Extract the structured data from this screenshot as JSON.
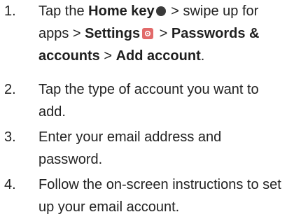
{
  "steps": [
    {
      "number": "1.",
      "segments": {
        "s1": "Tap the ",
        "s2": "Home key",
        "s3": " > swipe up for apps > ",
        "s4": "Settings",
        "s5": " > ",
        "s6": "Passwords & accounts",
        "s7": " > ",
        "s8": "Add account",
        "s9": "."
      },
      "icons": [
        "home-key-dot-icon",
        "settings-gear-icon"
      ]
    },
    {
      "number": "2.",
      "text": "Tap the type of account you want to add."
    },
    {
      "number": "3.",
      "text": "Enter your email address and password."
    },
    {
      "number": "4.",
      "text": "Follow the on-screen instructions to set up your email account."
    }
  ],
  "colors": {
    "text": "#222222",
    "home_key_dot": "#3a3a3a",
    "settings_icon_bg": "#e26a6a"
  }
}
